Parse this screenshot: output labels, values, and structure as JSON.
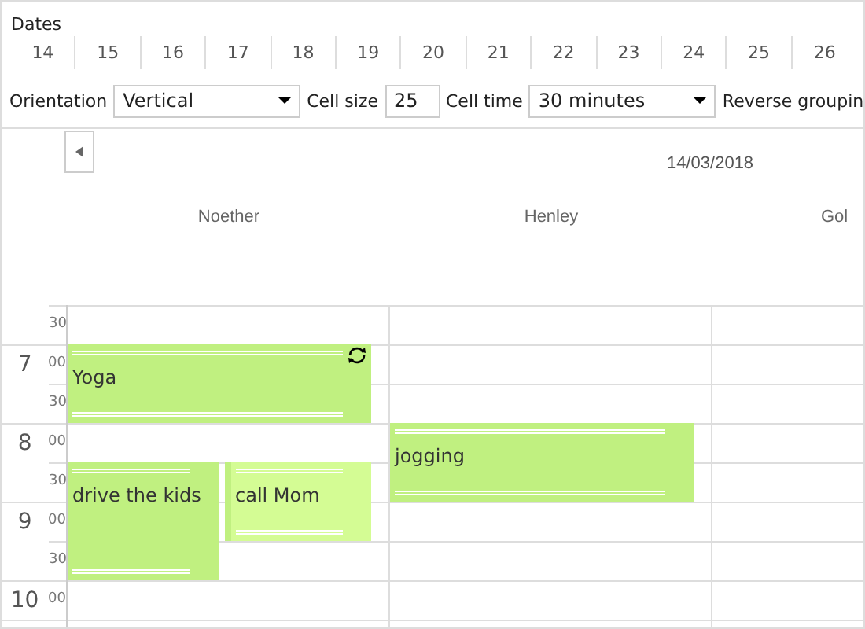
{
  "dates": {
    "label": "Dates",
    "days": [
      "14",
      "15",
      "16",
      "17",
      "18",
      "19",
      "20",
      "21",
      "22",
      "23",
      "24",
      "25",
      "26"
    ]
  },
  "toolbar": {
    "orientation": {
      "label": "Orientation",
      "value": "Vertical"
    },
    "cell_size": {
      "label": "Cell size",
      "value": "25"
    },
    "cell_time": {
      "label": "Cell time",
      "value": "30 minutes"
    },
    "reverse_grouping": {
      "label": "Reverse groupin"
    }
  },
  "scheduler": {
    "date": "14/03/2018",
    "hours": [
      {
        "slots": [
          "30"
        ]
      },
      {
        "label": "7",
        "slots": [
          "00",
          "30"
        ]
      },
      {
        "label": "8",
        "slots": [
          "00",
          "30"
        ]
      },
      {
        "label": "9",
        "slots": [
          "00",
          "30"
        ]
      },
      {
        "label": "10",
        "slots": [
          "00"
        ]
      }
    ],
    "resources": [
      {
        "name": "Noether",
        "events": [
          {
            "title": "Yoga",
            "recurring": true,
            "color": "#c0f080"
          },
          {
            "title": "drive the kids",
            "recurring": false,
            "color": "#c0f080"
          },
          {
            "title": "call Mom",
            "recurring": false,
            "color": "#d4fc94"
          }
        ]
      },
      {
        "name": "Henley",
        "events": [
          {
            "title": "jogging",
            "recurring": false,
            "color": "#c0f080"
          }
        ]
      },
      {
        "name": "Gol"
      }
    ]
  }
}
